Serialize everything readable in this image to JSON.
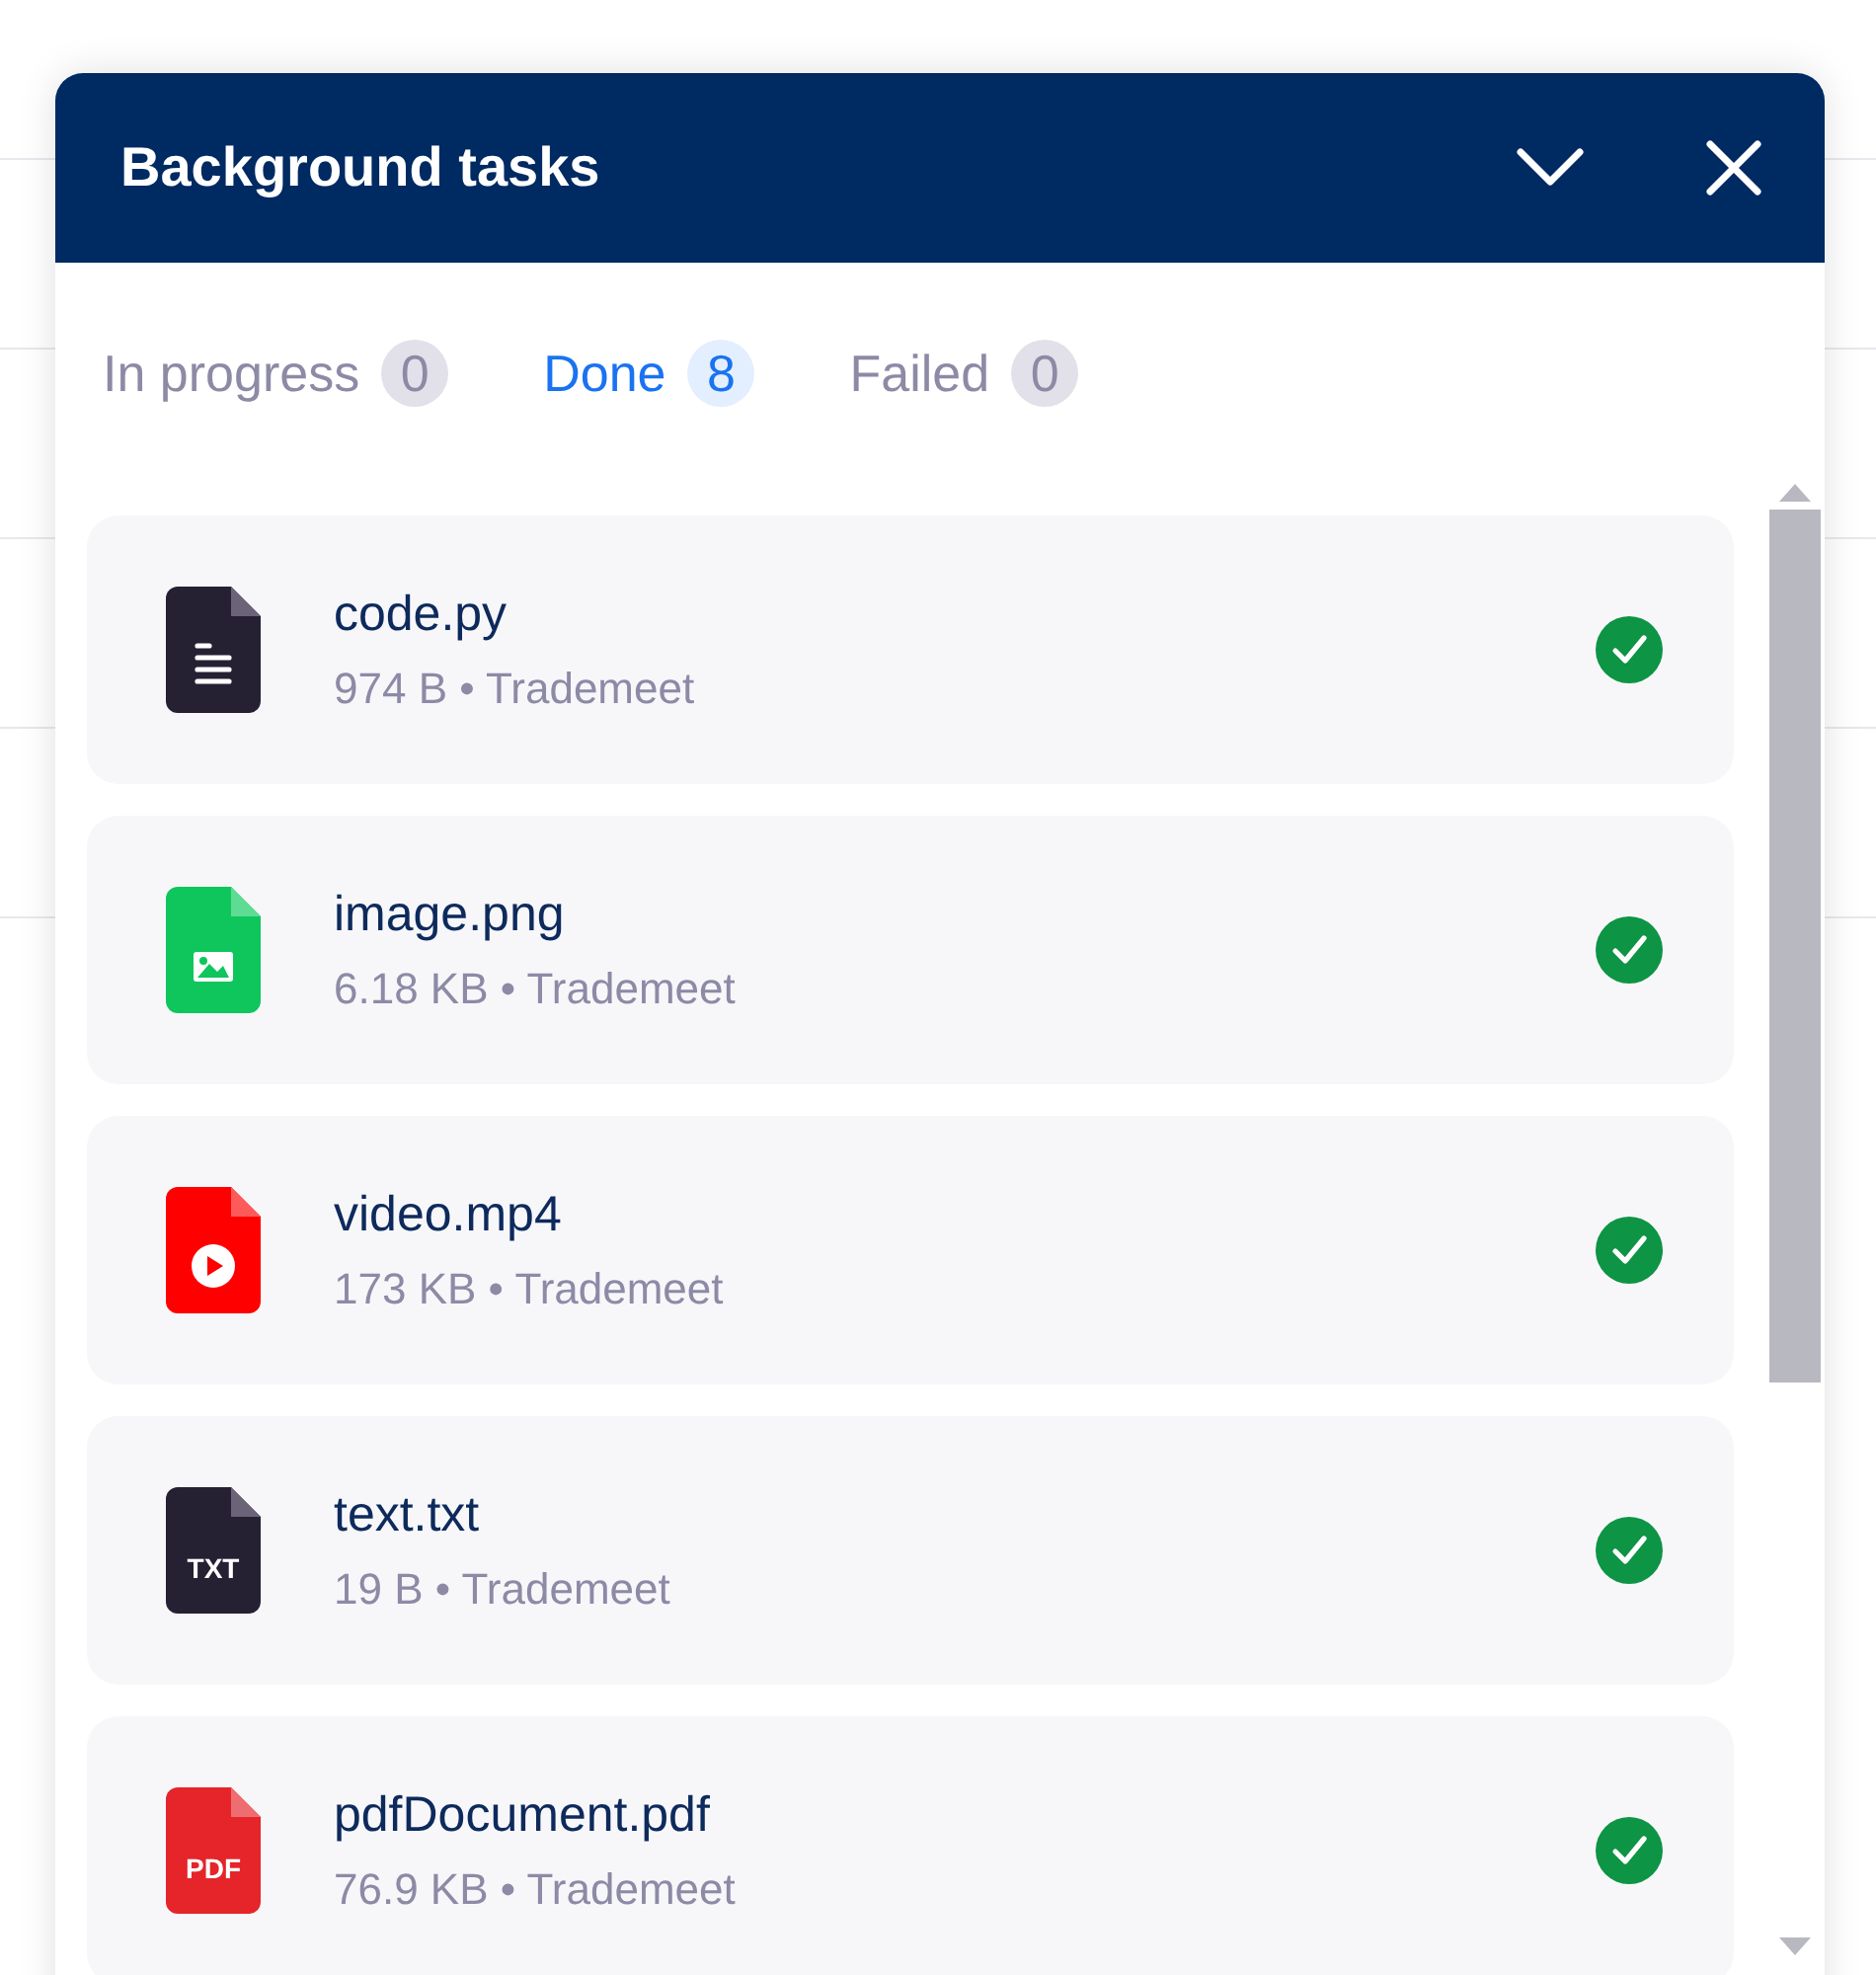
{
  "panel": {
    "title": "Background tasks",
    "tabs": [
      {
        "label": "In progress",
        "count": "0",
        "selected": false
      },
      {
        "label": "Done",
        "count": "8",
        "selected": true
      },
      {
        "label": "Failed",
        "count": "0",
        "selected": false
      }
    ],
    "tasks": [
      {
        "kind": "code",
        "name": "code.py",
        "meta": "974 B • Trademeet",
        "done": true
      },
      {
        "kind": "image",
        "name": "image.png",
        "meta": "6.18 KB • Trademeet",
        "done": true
      },
      {
        "kind": "video",
        "name": "video.mp4",
        "meta": "173 KB • Trademeet",
        "done": true
      },
      {
        "kind": "txt",
        "icon_label": "TXT",
        "name": "text.txt",
        "meta": "19 B • Trademeet",
        "done": true
      },
      {
        "kind": "pdf",
        "icon_label": "PDF",
        "name": "pdfDocument.pdf",
        "meta": "76.9 KB • Trademeet",
        "done": true
      }
    ]
  }
}
